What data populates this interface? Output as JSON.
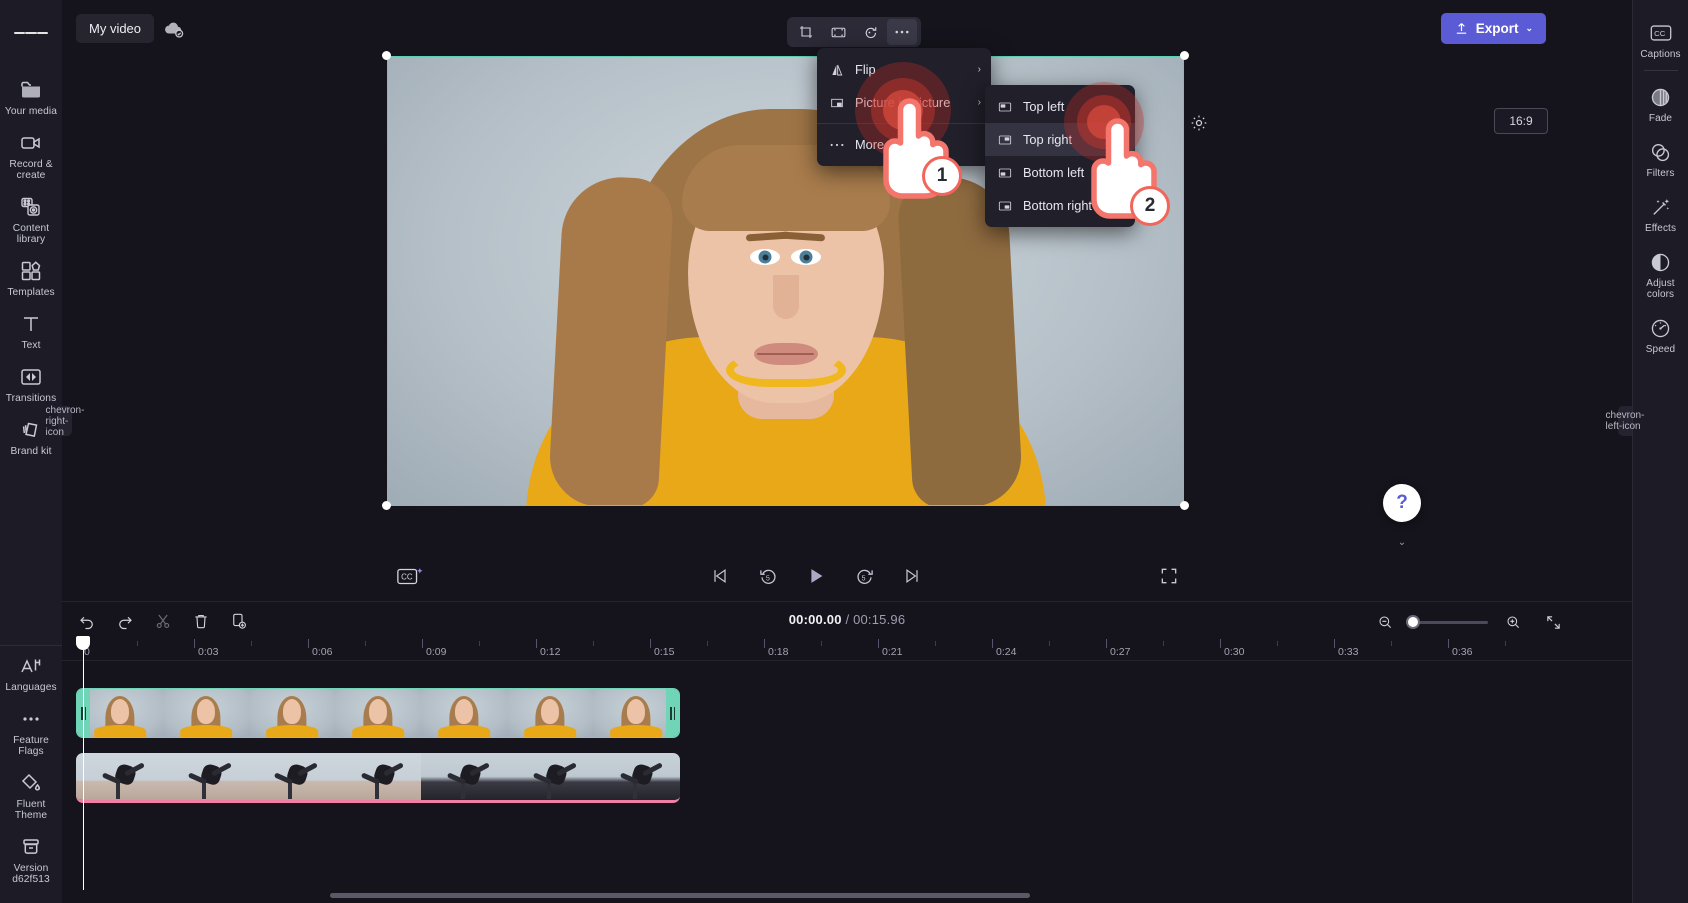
{
  "app": {
    "accent": "#5b5bd6",
    "selection_color": "#6fd5b6",
    "bg": "#15141c"
  },
  "topbar": {
    "project_name": "My video",
    "cloud_icon": "cloud-saved-icon",
    "export_label": "Export",
    "export_caret": "⌄",
    "menu_icon": "hamburger-icon"
  },
  "left_rail": {
    "items": [
      {
        "label": "Your media",
        "icon": "folder-icon"
      },
      {
        "label": "Record & create",
        "icon": "video-camera-icon"
      },
      {
        "label": "Content library",
        "icon": "content-library-icon"
      },
      {
        "label": "Templates",
        "icon": "templates-icon"
      },
      {
        "label": "Text",
        "icon": "text-icon"
      },
      {
        "label": "Transitions",
        "icon": "transitions-icon"
      },
      {
        "label": "Brand kit",
        "icon": "brand-kit-icon"
      }
    ],
    "bottom_items": [
      {
        "label": "Languages",
        "icon": "languages-icon"
      },
      {
        "label": "Feature Flags",
        "icon": "ellipsis-icon"
      },
      {
        "label": "Fluent Theme",
        "icon": "paint-bucket-icon"
      },
      {
        "label": "Version d62f513",
        "icon": "archive-box-icon"
      }
    ],
    "collapse_icon": "chevron-right-icon"
  },
  "right_rail": {
    "items": [
      {
        "label": "Captions",
        "icon": "closed-captions-icon"
      },
      {
        "label": "Fade",
        "icon": "fade-icon"
      },
      {
        "label": "Filters",
        "icon": "filters-icon"
      },
      {
        "label": "Effects",
        "icon": "magic-wand-icon"
      },
      {
        "label": "Adjust colors",
        "icon": "contrast-icon"
      },
      {
        "label": "Speed",
        "icon": "speedometer-icon"
      }
    ],
    "collapse_icon": "chevron-left-icon"
  },
  "stage": {
    "aspect_ratio": "16:9",
    "gear_icon": "gear-icon",
    "handles": [
      "top-left",
      "top-right",
      "bottom-left",
      "bottom-right"
    ]
  },
  "float_toolbar": {
    "buttons": [
      {
        "name": "crop-button",
        "icon": "crop-icon",
        "active": false
      },
      {
        "name": "fit-fill-button",
        "icon": "fit-frame-icon",
        "active": false
      },
      {
        "name": "rotate-button",
        "icon": "rotate-icon",
        "active": false
      },
      {
        "name": "more-options-button",
        "icon": "ellipsis-icon",
        "active": true
      }
    ]
  },
  "context_menu": {
    "items": [
      {
        "label": "Flip",
        "icon": "flip-icon",
        "has_submenu": true,
        "arrow": "›"
      },
      {
        "label": "Picture in picture",
        "icon": "picture-in-picture-icon",
        "has_submenu": true,
        "arrow": "›"
      },
      {
        "label": "More options",
        "icon": "ellipsis-icon",
        "has_submenu": false,
        "arrow": ""
      }
    ]
  },
  "submenu": {
    "items": [
      {
        "label": "Top left",
        "icon": "pip-top-left-icon",
        "selected": false
      },
      {
        "label": "Top right",
        "icon": "pip-top-right-icon",
        "selected": true
      },
      {
        "label": "Bottom left",
        "icon": "pip-bottom-left-icon",
        "selected": false
      },
      {
        "label": "Bottom right",
        "icon": "pip-bottom-right-icon",
        "selected": false
      }
    ]
  },
  "annotations": {
    "steps": [
      {
        "number": "1",
        "target": "Picture in picture"
      },
      {
        "number": "2",
        "target": "Top right"
      }
    ]
  },
  "player": {
    "cc_icon": "auto-captions-icon",
    "controls": [
      {
        "name": "skip-to-start-button",
        "icon": "skip-start-icon"
      },
      {
        "name": "rewind-5-button",
        "icon": "rewind-5-icon"
      },
      {
        "name": "play-button",
        "icon": "play-icon"
      },
      {
        "name": "forward-5-button",
        "icon": "forward-5-icon"
      },
      {
        "name": "skip-to-end-button",
        "icon": "skip-end-icon"
      }
    ],
    "fullscreen_icon": "fullscreen-icon",
    "help_label": "?"
  },
  "timeline": {
    "tools": [
      {
        "name": "undo-button",
        "icon": "undo-icon",
        "enabled": true
      },
      {
        "name": "redo-button",
        "icon": "redo-icon",
        "enabled": true
      },
      {
        "name": "split-button",
        "icon": "scissors-icon",
        "enabled": false
      },
      {
        "name": "delete-button",
        "icon": "trash-icon",
        "enabled": true
      },
      {
        "name": "duplicate-button",
        "icon": "duplicate-icon",
        "enabled": true
      }
    ],
    "current_time": "00:00.00",
    "total_time": "/ 00:15.96",
    "zoom_out_icon": "zoom-out-icon",
    "zoom_in_icon": "zoom-in-icon",
    "fit-timeline_icon": "fit-timeline-icon",
    "ruler_labels": [
      "0",
      "0:03",
      "0:06",
      "0:09",
      "0:12",
      "0:15",
      "0:18",
      "0:21",
      "0:24",
      "0:27",
      "0:30",
      "0:33",
      "0:36"
    ],
    "ruler_seconds_per_label": 3,
    "pixels_per_label": 114,
    "tracks": [
      {
        "name": "video-track",
        "clip_name": "portrait-clip",
        "selected": true,
        "thumbnails": 7
      },
      {
        "name": "overlay-track",
        "clip_name": "gymnast-clip",
        "selected": false,
        "thumbnails": 7
      }
    ]
  }
}
